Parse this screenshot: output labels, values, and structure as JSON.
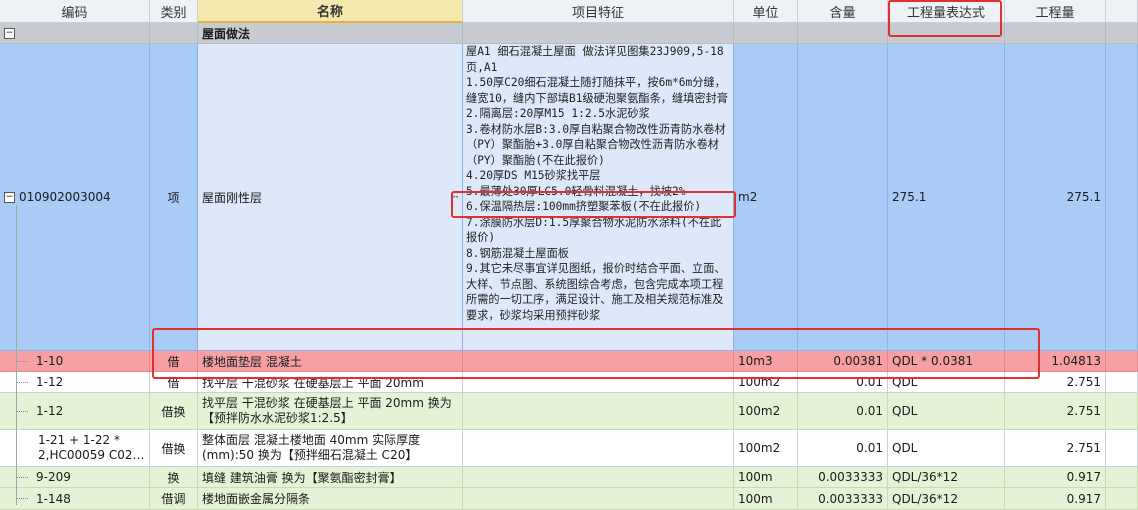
{
  "headers": [
    "编码",
    "类别",
    "名称",
    "项目特征",
    "单位",
    "含量",
    "工程量表达式",
    "工程量"
  ],
  "group": {
    "toggle": "−",
    "name": "屋面做法"
  },
  "main": {
    "toggle": "−",
    "code": "010902003004",
    "type": "项",
    "name": "屋面刚性层",
    "dots": "···",
    "features": [
      "屋A1  细石混凝土屋面  做法详见图集23J909,5-18页,A1",
      "1.50厚C20细石混凝土随打随抹平，按6m*6m分缝，缝宽10，缝内下部填B1级硬泡聚氨酯条，缝填密封膏",
      "2.隔离层:20厚M15 1:2.5水泥砂浆",
      "3.卷材防水层B:3.0厚自粘聚合物改性沥青防水卷材（PY）聚酯胎+3.0厚自粘聚合物改性沥青防水卷材（PY）聚酯胎(不在此报价)",
      "4.20厚DS M15砂浆找平层",
      "5.最薄处30厚LC5.0轻骨料混凝土，找坡2%",
      "6.保温隔热层:100mm挤塑聚苯板(不在此报价)",
      "7.涂膜防水层D:1.5厚聚合物水泥防水涂料(不在此报价)",
      "8.钢筋混凝土屋面板",
      "9.其它未尽事宜详见图纸，报价时结合平面、立面、大样、节点图、系统图综合考虑，包含完成本项工程所需的一切工序，满足设计、施工及相关规范标准及要求，砂浆均采用预拌砂浆"
    ],
    "unit": "m2",
    "qty_expr": "275.1",
    "quantity": "275.1"
  },
  "sub_rows": [
    {
      "code": "1-10",
      "type": "借",
      "name": "楼地面垫层 混凝土",
      "unit": "10m3",
      "content": "0.00381",
      "expr": "QDL * 0.0381",
      "quantity": "1.04813"
    },
    {
      "code": "1-12",
      "type": "借",
      "name": "找平层 干混砂浆 在硬基层上 平面 20mm",
      "unit": "100m2",
      "content": "0.01",
      "expr": "QDL",
      "quantity": "2.751"
    },
    {
      "code": "1-12",
      "type": "借换",
      "name": "找平层 干混砂浆 在硬基层上 平面 20mm 换为【预拌防水水泥砂浆1:2.5】",
      "unit": "100m2",
      "content": "0.01",
      "expr": "QDL",
      "quantity": "2.751"
    },
    {
      "code": "1-21 + 1-22 * 2,HC00059 C02…",
      "type": "借换",
      "name": "整体面层 混凝土楼地面 40mm  实际厚度(mm):50  换为【预拌细石混凝土 C20】",
      "unit": "100m2",
      "content": "0.01",
      "expr": "QDL",
      "quantity": "2.751"
    },
    {
      "code": "9-209",
      "type": "换",
      "name": "填缝 建筑油膏  换为【聚氨酯密封膏】",
      "unit": "100m",
      "content": "0.0033333",
      "expr": "QDL/36*12",
      "quantity": "0.917"
    },
    {
      "code": "1-148",
      "type": "借调",
      "name": "楼地面嵌金属分隔条",
      "unit": "100m",
      "content": "0.0033333",
      "expr": "QDL/36*12",
      "quantity": "0.917"
    }
  ],
  "colors": {
    "accent": "#e03030",
    "header_name_bg": "#f6e9b0",
    "main_row": "#a8ccf6",
    "selected_row": "#f6a0a4",
    "green_row": "#e4f3d6"
  }
}
